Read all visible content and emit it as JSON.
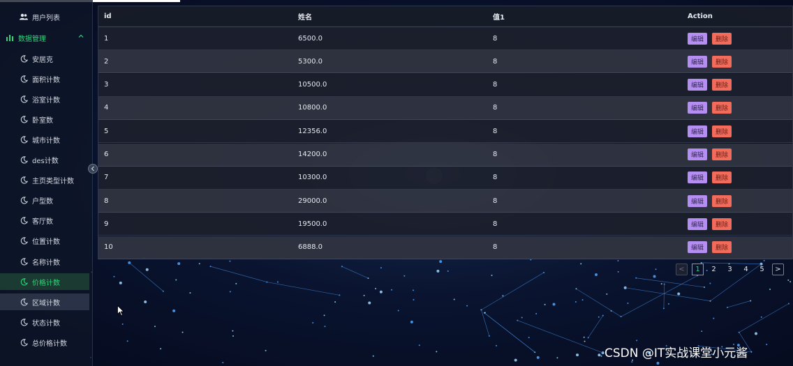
{
  "sidebar": {
    "user_list": "用户列表",
    "group": "数据管理",
    "items": [
      "安居克",
      "面积计数",
      "浴室计数",
      "卧室数",
      "城市计数",
      "des计数",
      "主页类型计数",
      "户型数",
      "客厅数",
      "位置计数",
      "名称计数",
      "价格计数",
      "区域计数",
      "状态计数",
      "总价格计数"
    ],
    "active_item": "价格计数",
    "hover_item": "区域计数"
  },
  "table": {
    "headers": {
      "id": "id",
      "name": "姓名",
      "value": "值1",
      "action": "Action"
    },
    "rows": [
      {
        "id": "1",
        "name": "6500.0",
        "value": "8"
      },
      {
        "id": "2",
        "name": "5300.0",
        "value": "8"
      },
      {
        "id": "3",
        "name": "10500.0",
        "value": "8"
      },
      {
        "id": "4",
        "name": "10800.0",
        "value": "8"
      },
      {
        "id": "5",
        "name": "12356.0",
        "value": "8"
      },
      {
        "id": "6",
        "name": "14200.0",
        "value": "8"
      },
      {
        "id": "7",
        "name": "10300.0",
        "value": "8"
      },
      {
        "id": "8",
        "name": "29000.0",
        "value": "8"
      },
      {
        "id": "9",
        "name": "19500.0",
        "value": "8"
      },
      {
        "id": "10",
        "name": "6888.0",
        "value": "8"
      }
    ],
    "edit_label": "编辑",
    "delete_label": "删除"
  },
  "pagination": {
    "prev": "<",
    "pages": [
      "1",
      "2",
      "3",
      "4",
      "5"
    ],
    "current": "1",
    "next": ">"
  },
  "watermark": "CSDN @IT实战课堂小元酱",
  "colors": {
    "accent_green": "#34d27b",
    "edit_button": "#b48ef0",
    "delete_button": "#f26b5b"
  }
}
